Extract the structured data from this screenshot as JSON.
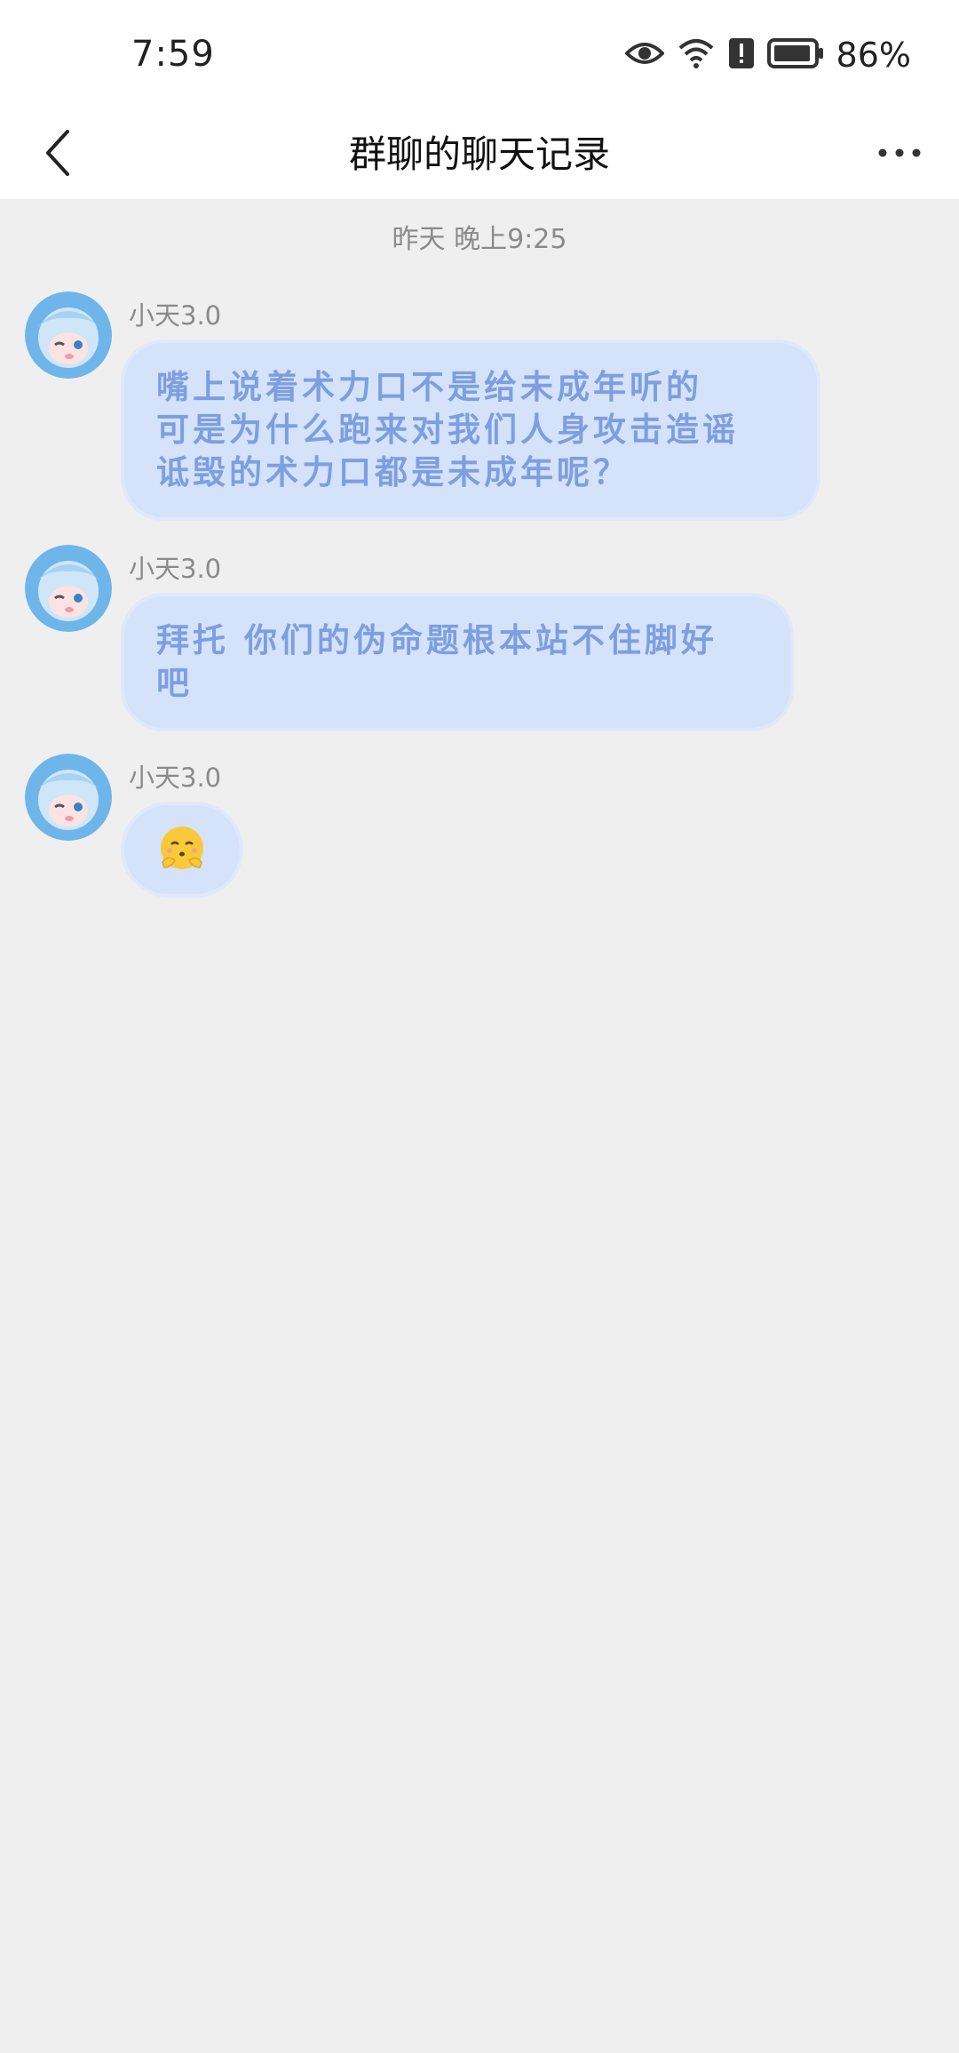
{
  "status_bar": {
    "time": "7:59",
    "battery_percent": "86%",
    "icons": [
      "eye-icon",
      "wifi-icon",
      "alert-icon",
      "battery-icon"
    ]
  },
  "header": {
    "title": "群聊的聊天记录"
  },
  "chat": {
    "timestamp": "昨天 晚上9:25",
    "messages": [
      {
        "sender": "小天3.0",
        "lines": [
          "嘴上说着术力口不是给未成年听的",
          "可是为什么跑来对我们人身攻击造谣",
          "诋毁的术力口都是未成年呢？"
        ]
      },
      {
        "sender": "小天3.0",
        "lines": [
          "拜托 你们的伪命题根本站不住脚好",
          "吧"
        ]
      },
      {
        "sender": "小天3.0",
        "emoji": "🫠"
      }
    ]
  },
  "colors": {
    "bubble_bg": "#d4e2fa",
    "bubble_text": "#7d9fe0",
    "page_bg": "#efefef"
  }
}
